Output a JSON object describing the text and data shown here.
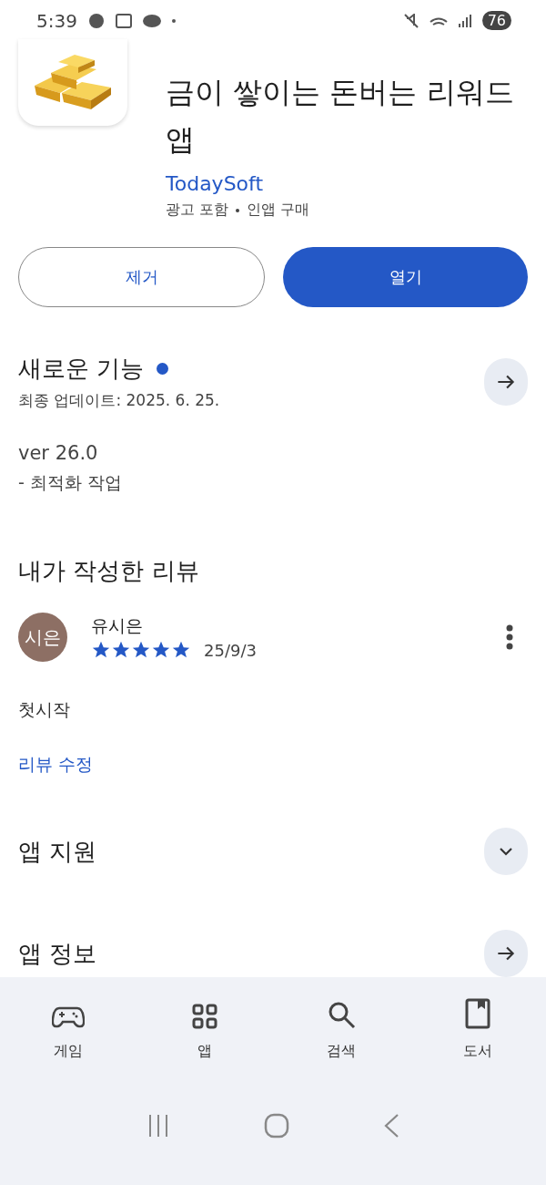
{
  "status_bar": {
    "time": "5:39",
    "battery": "76"
  },
  "app": {
    "title": "금이 쌓이는 돈버는 리워드 앱",
    "developer": "TodaySoft",
    "tags": [
      "광고 포함",
      "인앱 구매"
    ]
  },
  "buttons": [
    {
      "label": "제거",
      "kind": "outline"
    },
    {
      "label": "열기",
      "kind": "filled"
    }
  ],
  "whats_new": {
    "title": "새로운 기능",
    "new_indicator": true,
    "updated": "최종 업데이트: 2025. 6. 25.",
    "version": "ver 26.0",
    "notes": "- 최적화 작업"
  },
  "my_review": {
    "title": "내가 작성한 리뷰",
    "avatar": "시은",
    "author": "유시은",
    "stars": 5,
    "date": "25/9/3",
    "text": "첫시작",
    "edit_link": "리뷰 수정"
  },
  "sections": [
    {
      "title": "앱 지원",
      "kind": "expand"
    },
    {
      "title": "앱 정보",
      "kind": "arrow"
    }
  ],
  "bottom_nav": [
    {
      "label": "게임",
      "selected": false
    },
    {
      "label": "앱",
      "selected": false
    },
    {
      "label": "검색",
      "selected": false
    },
    {
      "label": "도서",
      "selected": false
    }
  ]
}
